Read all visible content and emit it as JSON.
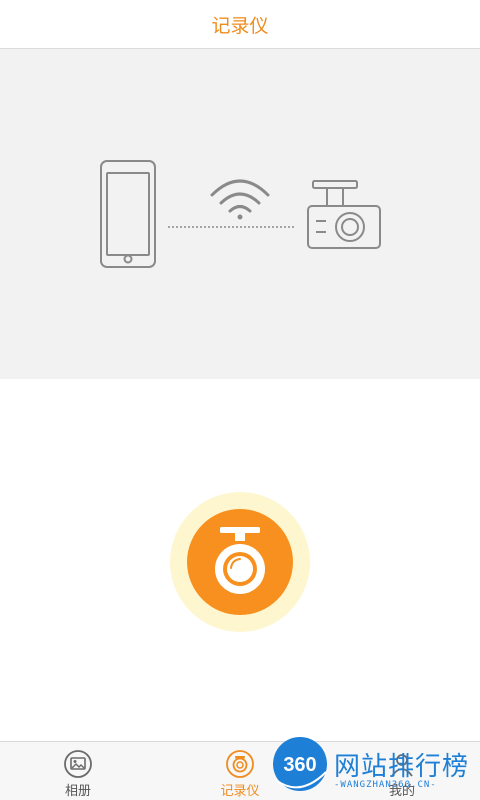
{
  "header": {
    "title": "记录仪"
  },
  "illustration": {
    "phone_icon": "smartphone-icon",
    "wifi_icon": "wifi-icon",
    "device_icon": "dashcam-icon"
  },
  "connect_button": {
    "icon": "dashcam-icon",
    "accent": "#f7901e",
    "halo": "#fdf6cf"
  },
  "tabbar": {
    "items": [
      {
        "label": "相册",
        "icon": "album-icon",
        "active": false
      },
      {
        "label": "记录仪",
        "icon": "recorder-icon",
        "active": true
      },
      {
        "label": "我的",
        "icon": "person-icon",
        "active": false
      }
    ]
  },
  "watermark": {
    "badge": "360",
    "text": "网站排行榜",
    "subtext": "-WANGZHAN360.CN-"
  },
  "colors": {
    "accent": "#f08c1e",
    "line": "#8a8a8a",
    "brand_watermark": "#1e7fd6"
  }
}
